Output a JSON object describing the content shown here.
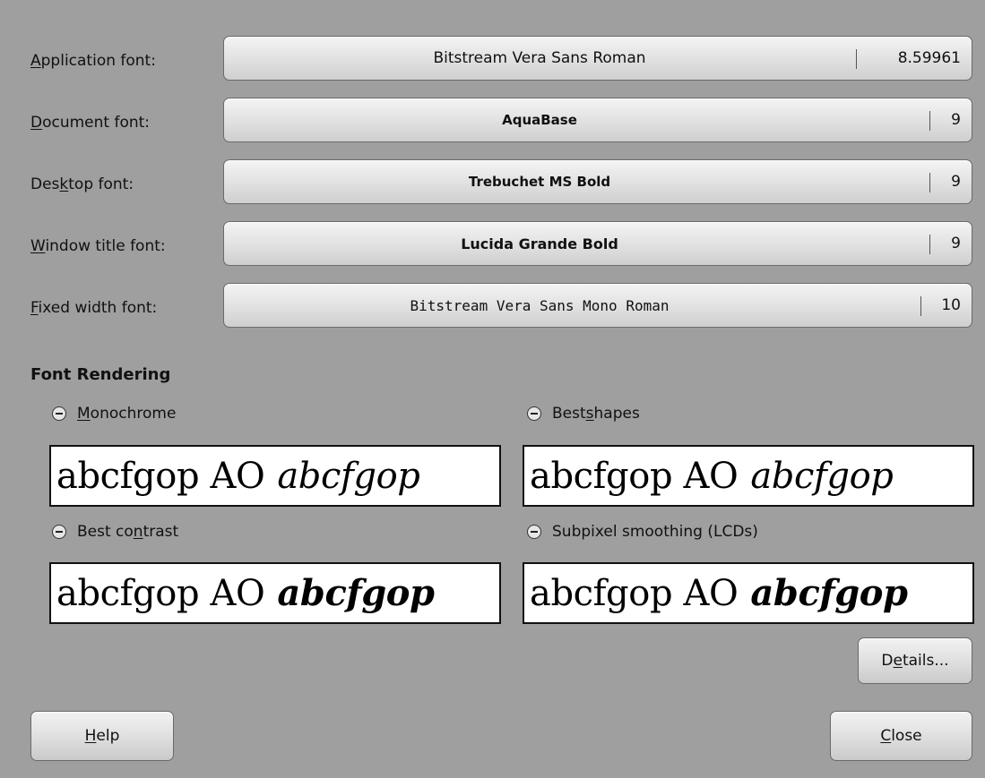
{
  "fonts": {
    "application": {
      "label_pre": "",
      "label_key": "A",
      "label_post": "pplication font:",
      "font": "Bitstream Vera Sans Roman",
      "size": "8.59961"
    },
    "document": {
      "label_pre": "",
      "label_key": "D",
      "label_post": "ocument font:",
      "font": "AquaBase",
      "size": "9"
    },
    "desktop": {
      "label_pre": "Des",
      "label_key": "k",
      "label_post": "top font:",
      "font": "Trebuchet MS Bold",
      "size": "9"
    },
    "window_title": {
      "label_pre": "",
      "label_key": "W",
      "label_post": "indow title font:",
      "font": "Lucida Grande Bold",
      "size": "9"
    },
    "fixed_width": {
      "label_pre": "",
      "label_key": "F",
      "label_post": "ixed width font:",
      "font": "Bitstream Vera Sans Mono Roman",
      "size": "10"
    }
  },
  "rendering": {
    "title": "Font Rendering",
    "sample_regular": "abcfgop AO",
    "sample_italic": "abcfgop",
    "options": {
      "monochrome": {
        "pre": "",
        "key": "M",
        "post": "onochrome"
      },
      "best_shapes": {
        "pre": "Best ",
        "key": "s",
        "post": "hapes"
      },
      "best_contrast": {
        "pre": "Best co",
        "key": "n",
        "post": "trast"
      },
      "subpixel": {
        "pre": "Subpixel smoothing (LCDs)",
        "key": "",
        "post": ""
      }
    }
  },
  "buttons": {
    "details": {
      "pre": "D",
      "key": "e",
      "post": "tails..."
    },
    "help": {
      "pre": "",
      "key": "H",
      "post": "elp"
    },
    "close": {
      "pre": "",
      "key": "C",
      "post": "lose"
    }
  }
}
